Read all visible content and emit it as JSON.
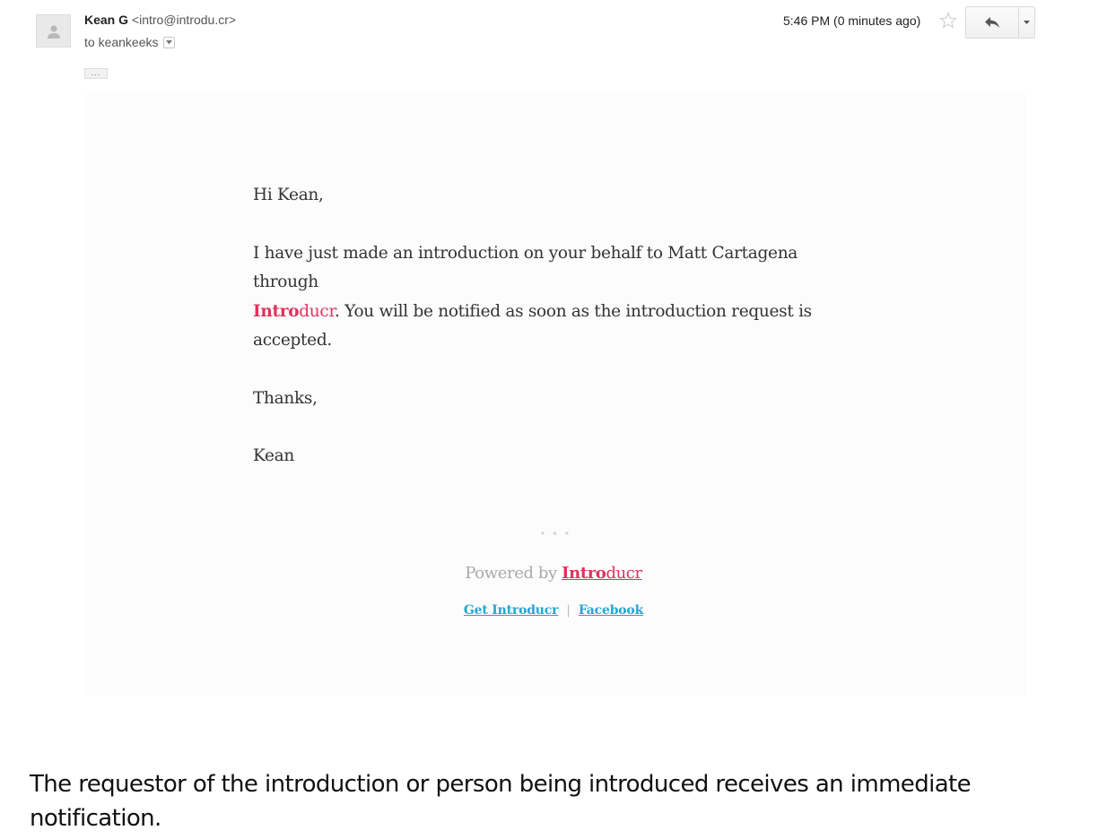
{
  "header": {
    "sender_name": "Kean G",
    "sender_email": "<intro@introdu.cr>",
    "to_text": "to keankeeks",
    "timestamp": "5:46 PM (0 minutes ago)",
    "show_trimmed_content": "..."
  },
  "email": {
    "greeting": "Hi Kean,",
    "para1_part1": "I have just made an introduction on your behalf to Matt Cartagena through",
    "brand_intro": "Intro",
    "brand_ducr": "ducr",
    "para1_part2": ". You will be notified as soon as the introduction request is accepted.",
    "thanks": "Thanks,",
    "signature": "Kean",
    "divider_dots": "• • •",
    "powered_by": "Powered by",
    "powered_brand_intro": "Intro",
    "powered_brand_ducr": "ducr",
    "link_get": "Get Introducr",
    "link_sep": "|",
    "link_facebook": "Facebook"
  },
  "caption": "The requestor of the introduction or person being introduced receives an immediate notification.",
  "colors": {
    "brand_pink": "#e0325d",
    "link_blue": "#2aa4cf",
    "card_bg": "#fcfcfc"
  }
}
